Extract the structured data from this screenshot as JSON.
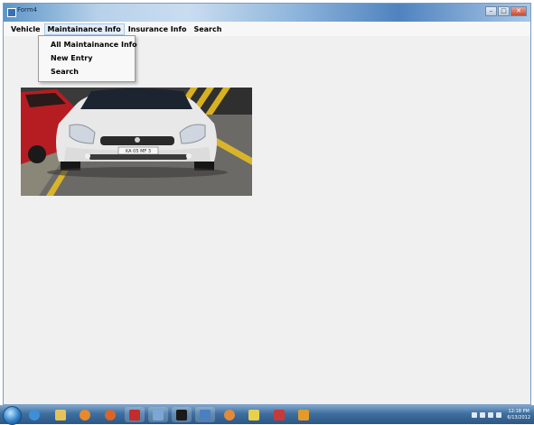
{
  "window": {
    "title": "Form4"
  },
  "menu": {
    "items": [
      {
        "label": "Vehicle"
      },
      {
        "label": "Maintainance Info"
      },
      {
        "label": "Insurance Info"
      },
      {
        "label": "Search"
      }
    ],
    "dropdown": [
      {
        "label": "All Maintainance Info"
      },
      {
        "label": "New Entry"
      },
      {
        "label": "Search"
      }
    ]
  },
  "photo": {
    "plate_text": "KA 05 MF 3"
  },
  "taskbar": {
    "time": "12:18 PM",
    "date": "6/13/2012",
    "pinned": [
      "ie-icon",
      "folder-icon",
      "media-player-icon",
      "firefox-icon",
      "app-red-icon",
      "app-blue-icon",
      "app-doc-icon",
      "terminal-icon",
      "app-window-icon",
      "paint-icon",
      "app-yellow-icon",
      "acrobat-icon",
      "app-flag-icon"
    ]
  }
}
